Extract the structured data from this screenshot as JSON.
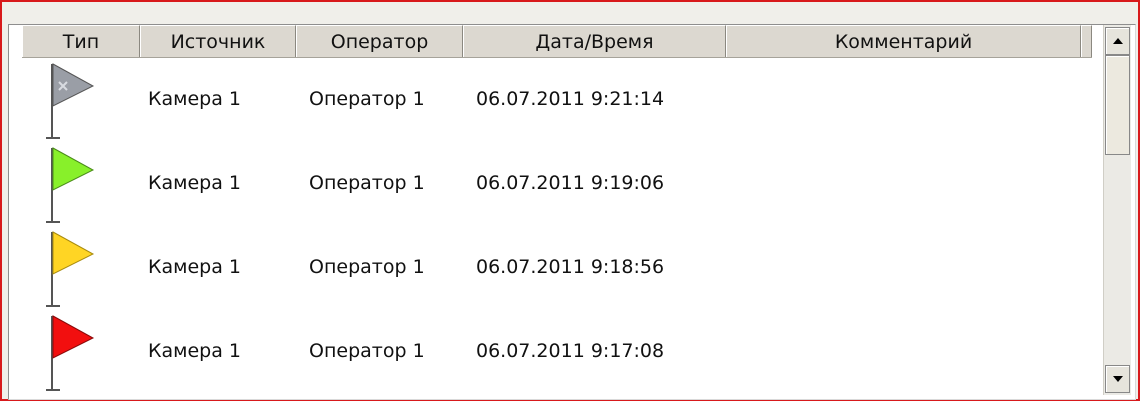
{
  "columns": [
    "Тип",
    "Источник",
    "Оператор",
    "Дата/Время",
    "Комментарий"
  ],
  "rows": [
    {
      "type_icon": "gray-flag-icon",
      "flag_color": "#9a9ea6",
      "source": "Камера 1",
      "operator": "Оператор 1",
      "datetime": "06.07.2011 9:21:14",
      "comment": ""
    },
    {
      "type_icon": "green-flag-icon",
      "flag_color": "#88f02a",
      "source": "Камера 1",
      "operator": "Оператор 1",
      "datetime": "06.07.2011 9:19:06",
      "comment": ""
    },
    {
      "type_icon": "yellow-flag-icon",
      "flag_color": "#ffd524",
      "source": "Камера 1",
      "operator": "Оператор 1",
      "datetime": "06.07.2011 9:18:56",
      "comment": ""
    },
    {
      "type_icon": "red-flag-icon",
      "flag_color": "#f20f0f",
      "source": "Камера 1",
      "operator": "Оператор 1",
      "datetime": "06.07.2011 9:17:08",
      "comment": ""
    }
  ],
  "scrollbar": {
    "up_icon": "arrow-up-icon",
    "down_icon": "arrow-down-icon"
  },
  "frame_border_color": "#d8191b"
}
